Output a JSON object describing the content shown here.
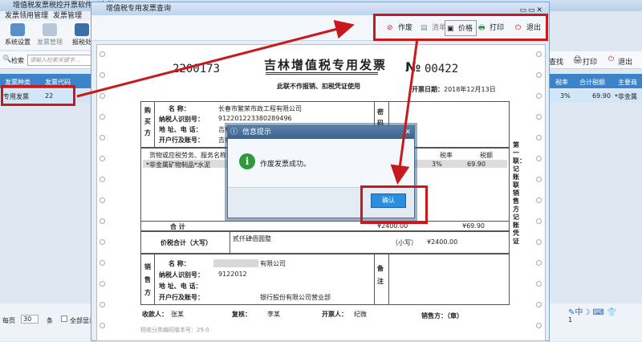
{
  "app": {
    "title": "增值税发票税控开票软件（金税",
    "menu": [
      "发票领用管理",
      "发票管理"
    ],
    "toolbar": [
      "系统设置",
      "发票管理",
      "报税处"
    ],
    "search_label": "检索",
    "search_placeholder": "请输入检索关键字...",
    "grid_headers": [
      "发票种类",
      "发票代码"
    ],
    "grid_row": [
      "专用发票",
      "22"
    ],
    "right_tools": [
      "查找",
      "打印",
      "退出"
    ],
    "right_headers": [
      "税率",
      "合计税额",
      "主要商"
    ],
    "right_row": [
      "3%",
      "69.90",
      "*非金属"
    ],
    "footer": {
      "per_page": "每页",
      "count": "30",
      "unit": "条",
      "select_all": "全部显示"
    },
    "page_num": "1"
  },
  "window": {
    "title": "增值税专用发票查询",
    "buttons": {
      "void": "作废",
      "clear": "清单",
      "price": "价格",
      "print": "打印",
      "exit": "退出"
    }
  },
  "invoice": {
    "code": "2200173",
    "title": "吉林增值税专用发票",
    "no_symbol": "№",
    "number": "00422",
    "subtitle": "此联不作报销、扣税凭证使用",
    "date_label": "开票日期：",
    "date": "2018年12月13日",
    "buyer_side": "购买方",
    "buyer_name_label": "名    称：",
    "buyer_name": "长春市繁荣市政工程有限公司",
    "buyer_tax_label": "纳税人识别号：",
    "buyer_tax": "912201223380289496",
    "buyer_addr_label": "地 址、电 话：",
    "buyer_addr": "吉林省长春市",
    "buyer_bank_label": "开户行及账号：",
    "buyer_bank": "吉林省长春",
    "cipher_label": "密码区",
    "item_header": "货物或应税劳务、服务名称",
    "item": "*非金属矿物制品*水泥",
    "rate_header": "税率",
    "tax_header": "税额",
    "rate": "3%",
    "tax": "69.90",
    "total_label": "合        计",
    "amount_total": "¥2400.00",
    "tax_total": "¥69.90",
    "sum_label": "价税合计（大写）",
    "sum_upper": "贰仟肆佰圆整",
    "sum_lower_label": "（小写）",
    "sum_lower": "¥2400.00",
    "seller_side": "销售方",
    "seller_name_suffix": "有限公司",
    "seller_tax": "9122012",
    "seller_bank": "银行股份有限公司营业部",
    "remark_label": "备注",
    "payee_label": "收款人：",
    "payee": "张某",
    "reviewer_label": "复核：",
    "reviewer": "李某",
    "drawer_label": "开票人：",
    "drawer": "纪微",
    "seller_sign": "销售方：（章）",
    "version": "税收分类编码版本号：29.0",
    "side_text": "第一联：记账联  销售方记账凭证"
  },
  "dialog": {
    "title": "信息提示",
    "message": "作废发票成功。",
    "ok": "确认"
  }
}
